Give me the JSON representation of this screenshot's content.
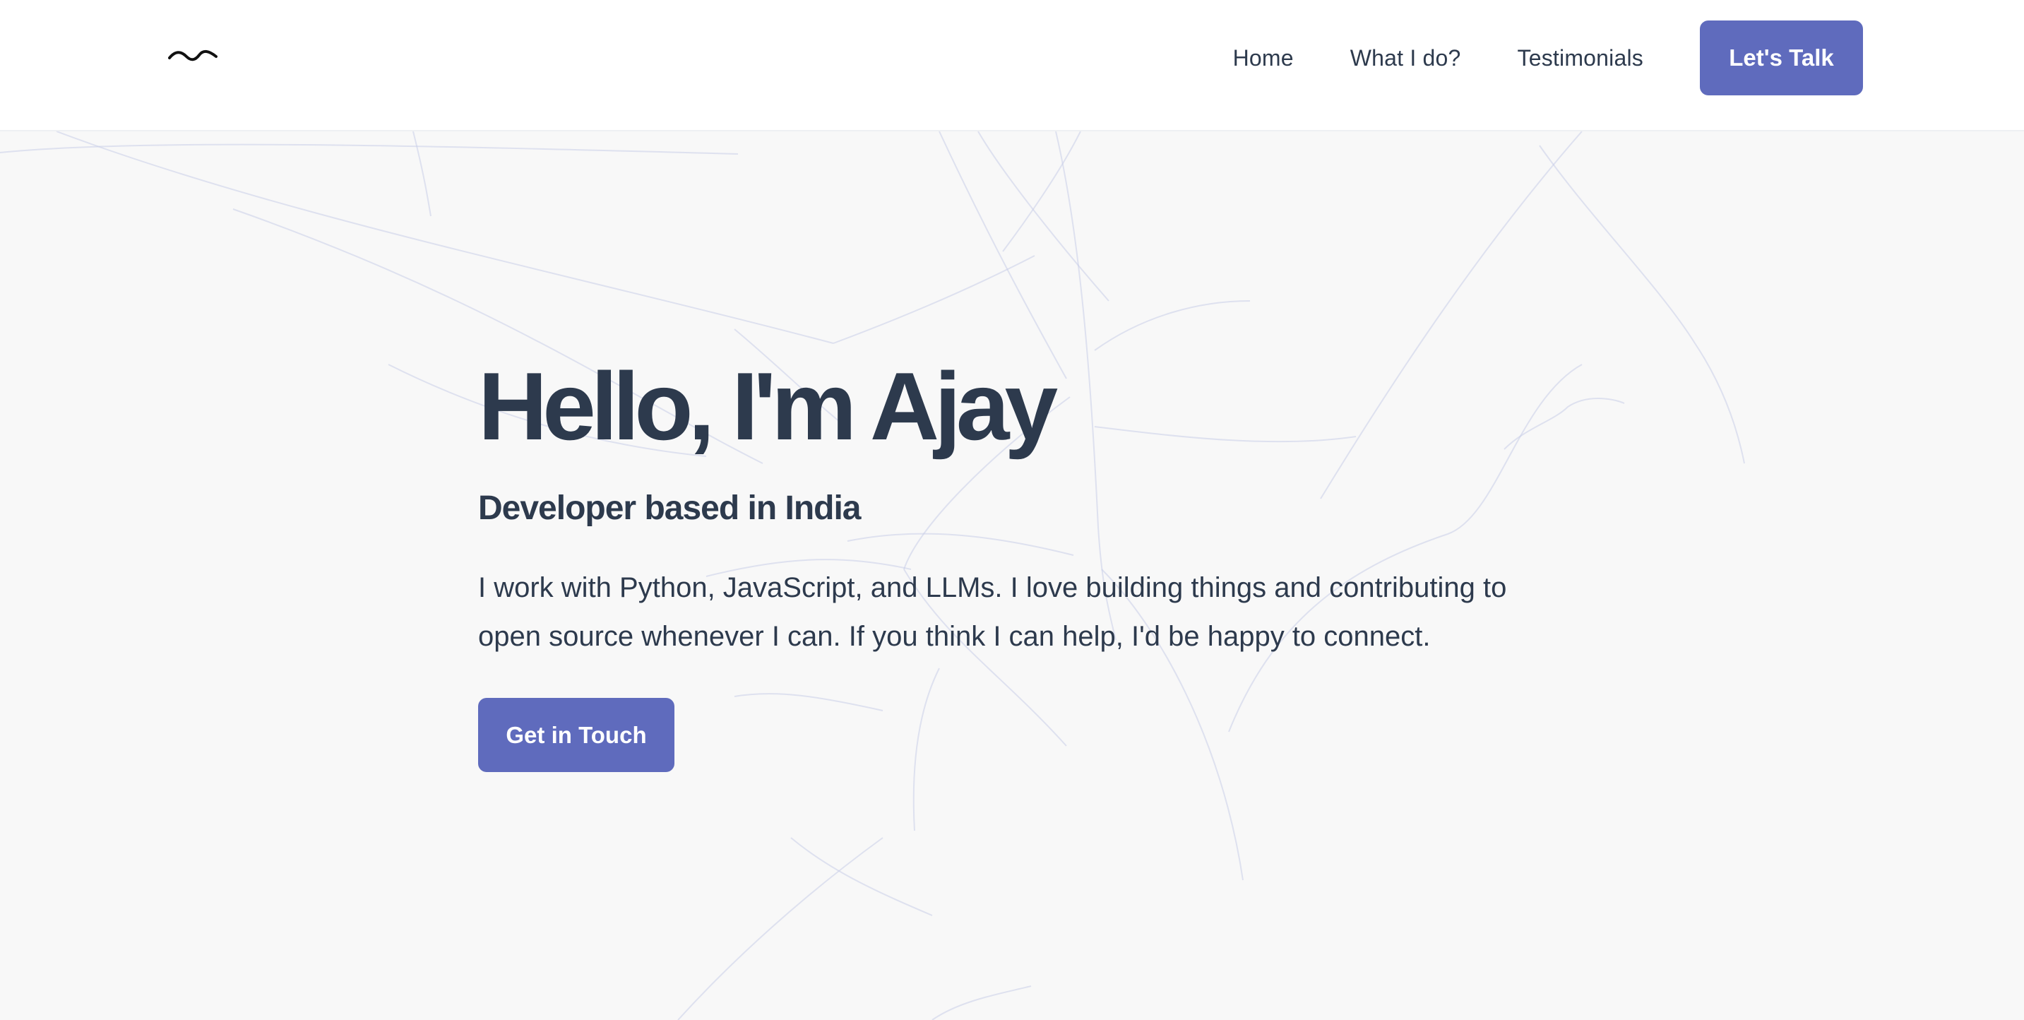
{
  "header": {
    "logo_icon": "bird-logo-icon",
    "nav": [
      {
        "label": "Home"
      },
      {
        "label": "What I do?"
      },
      {
        "label": "Testimonials"
      }
    ],
    "cta_label": "Let's Talk"
  },
  "hero": {
    "title": "Hello, I'm Ajay",
    "subtitle": "Developer based in India",
    "description": "I work with Python, JavaScript, and LLMs. I love building things and contributing to open source whenever I can. If you think I can help, I'd be happy to connect.",
    "cta_label": "Get in Touch"
  },
  "colors": {
    "accent": "#5f6bbd",
    "text": "#2d3a4d",
    "background": "#f8f8f8",
    "header_background": "#ffffff",
    "decorative_lines": "#c9cde8"
  }
}
